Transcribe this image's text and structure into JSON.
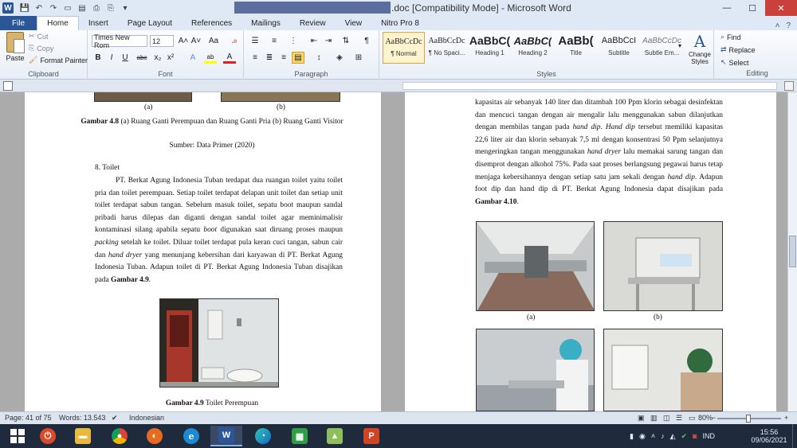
{
  "window": {
    "title": ".doc [Compatibility Mode]  -  Microsoft Word",
    "app_icon": "W",
    "controls": {
      "minimize": "—",
      "maximize": "☐",
      "close": "✕"
    }
  },
  "ribbon_tabs": [
    "File",
    "Home",
    "Insert",
    "Page Layout",
    "References",
    "Mailings",
    "Review",
    "View",
    "Nitro Pro 8"
  ],
  "active_tab": "Home",
  "clipboard": {
    "paste": "Paste",
    "cut": "Cut",
    "copy": "Copy",
    "format_painter": "Format Painter",
    "label": "Clipboard"
  },
  "font": {
    "family": "Times New Rom",
    "size": "12",
    "label": "Font",
    "buttons": {
      "bold": "B",
      "italic": "I",
      "underline": "U",
      "strike": "abc",
      "subscript": "x₂",
      "superscript": "x²",
      "grow": "A˄",
      "shrink": "A˅",
      "case": "Aa",
      "text_effects": "A",
      "highlight": "ab",
      "font_color": "A"
    }
  },
  "paragraph": {
    "label": "Paragraph",
    "show_marks": "¶"
  },
  "styles": {
    "label": "Styles",
    "items": [
      {
        "sample": "AaBbCcDc",
        "name": "¶ Normal"
      },
      {
        "sample": "AaBbCcDc",
        "name": "¶ No Spaci..."
      },
      {
        "sample": "AaBbC(",
        "name": "Heading 1"
      },
      {
        "sample": "AaBbC(",
        "name": "Heading 2"
      },
      {
        "sample": "AaBb(",
        "name": "Title"
      },
      {
        "sample": "AaBbCcI",
        "name": "Subtitle"
      },
      {
        "sample": "AaBbCcDc",
        "name": "Subtle Em..."
      }
    ],
    "change_styles": "Change Styles"
  },
  "editing": {
    "label": "Editing",
    "find": "Find",
    "replace": "Replace",
    "select": "Select"
  },
  "left_page": {
    "fig48_sub_a": "(a)",
    "fig48_sub_b": "(b)",
    "fig48_caption_bold": "Gambar 4.8",
    "fig48_caption_text": " (a) Ruang Ganti Perempuan dan Ruang Ganti Pria (b) Ruang Ganti Visitor",
    "fig48_source": "Sumber: Data Primer (2020)",
    "section_heading": "8. Toilet",
    "body_1": "PT. Berkat Agung Indonesia Tuban terdapat dua ruangan toilet yaitu toilet pria dan toilet perempuan. Setiap toilet terdapat delapan unit toilet dan setiap unit toilet terdapat sabun tangan. Sebelum masuk toilet, sepatu boot maupun sandal pribadi harus dilepas dan diganti dengan sandal toilet agar meminimalisir kontaminasi silang apabila sepatu ",
    "body_boot": "boot",
    "body_2": " digunakan saat diruang proses maupun ",
    "body_packing": "packing",
    "body_3": " setelah ke toilet. Diluar toilet terdapat pula keran cuci tangan, sabun cair dan ",
    "body_handdryer": "hand dryer",
    "body_4": " yang menunjang kebersihan dari karyawan di PT. Berkat Agung Indonesia Tuban. Adapun toilet di PT. Berkat Agung Indonesia Tuban disajikan pada ",
    "body_ref": "Gambar 4.9",
    "body_end": ".",
    "fig49_caption_bold": "Gambar 4.9",
    "fig49_caption_text": " Toilet Perempuan"
  },
  "right_page": {
    "body_1": "kapasitas air sebanyak 140 liter dan ditambah 100 Ppm klorin sebagai desinfektan dan mencuci tangan dengan air mengalir lalu menggunakan sabun dilanjutkan dengan membilas tangan pada ",
    "hd1": "hand dip",
    "body_2": ". ",
    "hd2": "Hand dip",
    "body_3": " tersebut memiliki kapasitas 22,6 liter air dan klorin sebanyak 7,5 ml dengan konsentrasi 50 Ppm selanjutnya mengeringkan tangan menggunakan ",
    "hdry": "hand dryer",
    "body_4": " lalu memakai sarung tangan dan disemprot dengan alkohol 75%. Pada saat proses berlangsung pegawai harus tetap menjaga kebersihannya dengan setiap satu jam sekali dengan ",
    "hd3": "hand dip",
    "body_5": ". Adapun foot dip dan hand dip di PT. Berkat Agung Indonesia dapat disajikan pada ",
    "ref": "Gambar 4.10",
    "body_end": ".",
    "sub_a": "(a)",
    "sub_b": "(b)"
  },
  "status": {
    "page": "Page: 41 of 75",
    "words": "Words: 13.543",
    "language": "Indonesian",
    "zoom": "80%",
    "zoom_minus": "−",
    "zoom_plus": "+"
  },
  "taskbar": {
    "time": "15:56",
    "date": "09/06/2021",
    "lang": "IND"
  }
}
